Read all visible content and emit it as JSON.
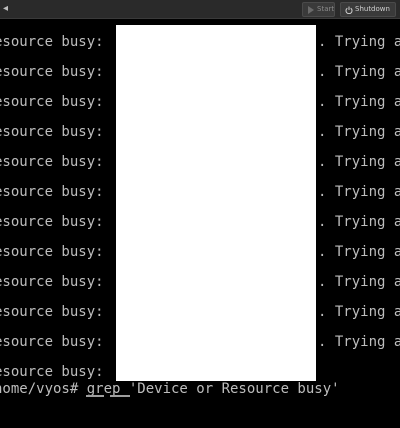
{
  "toolbar": {
    "left_glyph": "◂",
    "start_label": "Start",
    "shutdown_label": "Shutdown"
  },
  "terminal": {
    "lines": [
      {
        "left": "esource busy:",
        "right": ". Trying a"
      },
      {
        "left": "esource busy:",
        "right": ". Trying a"
      },
      {
        "left": "esource busy:",
        "right": ". Trying a"
      },
      {
        "left": "esource busy:",
        "right": ". Trying a"
      },
      {
        "left": "esource busy:",
        "right": ". Trying a"
      },
      {
        "left": "esource busy:",
        "right": ". Trying a"
      },
      {
        "left": "esource busy:",
        "right": ". Trying a"
      },
      {
        "left": "esource busy:",
        "right": ". Trying a"
      },
      {
        "left": "esource busy:",
        "right": ". Trying a"
      },
      {
        "left": "esource busy:",
        "right": ". Trying a"
      },
      {
        "left": "esource busy:",
        "right": ". Trying a"
      },
      {
        "left": "esource busy:",
        "right": ""
      }
    ],
    "prompt": "home/vyos# grep 'Device or Resource busy'"
  }
}
